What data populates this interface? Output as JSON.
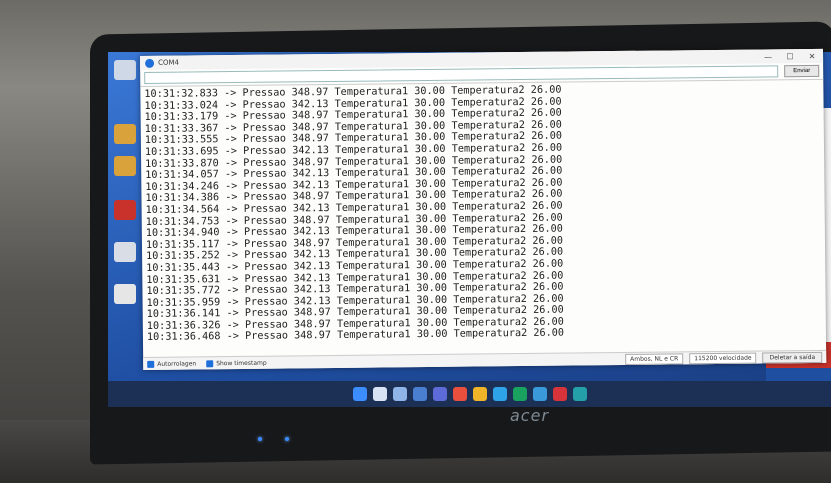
{
  "window": {
    "title": "COM4",
    "minimize": "—",
    "maximize": "☐",
    "close": "✕"
  },
  "input": {
    "value": "",
    "send_label": "Enviar"
  },
  "log_lines": [
    "10:31:32.833 -> Pressao 348.97 Temperatura1 30.00 Temperatura2 26.00",
    "10:31:33.024 -> Pressao 342.13 Temperatura1 30.00 Temperatura2 26.00",
    "10:31:33.179 -> Pressao 348.97 Temperatura1 30.00 Temperatura2 26.00",
    "10:31:33.367 -> Pressao 348.97 Temperatura1 30.00 Temperatura2 26.00",
    "10:31:33.555 -> Pressao 348.97 Temperatura1 30.00 Temperatura2 26.00",
    "10:31:33.695 -> Pressao 342.13 Temperatura1 30.00 Temperatura2 26.00",
    "10:31:33.870 -> Pressao 348.97 Temperatura1 30.00 Temperatura2 26.00",
    "10:31:34.057 -> Pressao 342.13 Temperatura1 30.00 Temperatura2 26.00",
    "10:31:34.246 -> Pressao 342.13 Temperatura1 30.00 Temperatura2 26.00",
    "10:31:34.386 -> Pressao 348.97 Temperatura1 30.00 Temperatura2 26.00",
    "10:31:34.564 -> Pressao 342.13 Temperatura1 30.00 Temperatura2 26.00",
    "10:31:34.753 -> Pressao 348.97 Temperatura1 30.00 Temperatura2 26.00",
    "10:31:34.940 -> Pressao 342.13 Temperatura1 30.00 Temperatura2 26.00",
    "10:31:35.117 -> Pressao 348.97 Temperatura1 30.00 Temperatura2 26.00",
    "10:31:35.252 -> Pressao 342.13 Temperatura1 30.00 Temperatura2 26.00",
    "10:31:35.443 -> Pressao 342.13 Temperatura1 30.00 Temperatura2 26.00",
    "10:31:35.631 -> Pressao 342.13 Temperatura1 30.00 Temperatura2 26.00",
    "10:31:35.772 -> Pressao 342.13 Temperatura1 30.00 Temperatura2 26.00",
    "10:31:35.959 -> Pressao 342.13 Temperatura1 30.00 Temperatura2 26.00",
    "10:31:36.141 -> Pressao 348.97 Temperatura1 30.00 Temperatura2 26.00",
    "10:31:36.326 -> Pressao 348.97 Temperatura1 30.00 Temperatura2 26.00",
    "10:31:36.468 -> Pressao 348.97 Temperatura1 30.00 Temperatura2 26.00"
  ],
  "status": {
    "autoscroll": "Autorrolagen",
    "timestamp": "Show timestamp",
    "line_ending": "Ambos, NL e CR",
    "baud": "115200 velocidade",
    "clear": "Deletar a saída"
  },
  "brand": "acer",
  "colors": {
    "accent": "#1e6fd9",
    "wallpaper": "#2a5db0",
    "taskbar": "#1c2f55"
  }
}
